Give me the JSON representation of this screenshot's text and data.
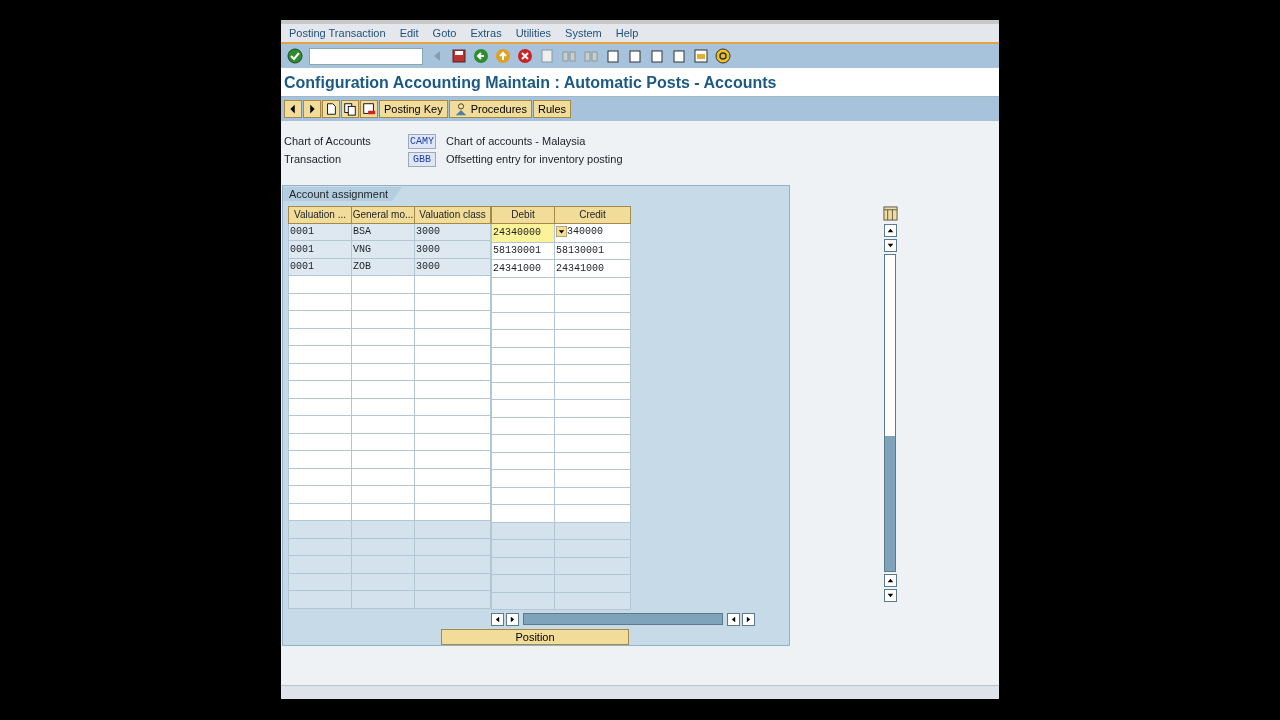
{
  "menu": [
    "Posting Transaction",
    "Edit",
    "Goto",
    "Extras",
    "Utilities",
    "System",
    "Help"
  ],
  "title": "Configuration Accounting Maintain : Automatic Posts - Accounts",
  "app_toolbar": [
    {
      "kind": "icon"
    },
    {
      "kind": "icon"
    },
    {
      "kind": "icon"
    },
    {
      "kind": "icon"
    },
    {
      "kind": "icon"
    },
    {
      "kind": "text",
      "label": "Posting Key"
    },
    {
      "kind": "iconText",
      "label": "Procedures"
    },
    {
      "kind": "text",
      "label": "Rules"
    }
  ],
  "fields": [
    {
      "label": "Chart of Accounts",
      "value": "CAMY",
      "description": "Chart of accounts - Malaysia"
    },
    {
      "label": "Transaction",
      "value": "GBB",
      "description": "Offsetting entry for inventory posting"
    }
  ],
  "group": {
    "title": "Account assignment",
    "key_columns": [
      "Valuation ...",
      "General mo...",
      "Valuation class"
    ],
    "account_columns": [
      "Debit",
      "Credit"
    ],
    "rows": [
      {
        "cells": [
          "0001",
          "BSA",
          "3000"
        ],
        "debit": "24340000",
        "credit": "340000",
        "focused": true,
        "dropdown": true
      },
      {
        "cells": [
          "0001",
          "VNG",
          "3000"
        ],
        "debit": "58130001",
        "credit": "58130001",
        "focused": false,
        "dropdown": false
      },
      {
        "cells": [
          "0001",
          "ZOB",
          "3000"
        ],
        "debit": "24341000",
        "credit": "24341000",
        "focused": false,
        "dropdown": false
      }
    ],
    "button": "Position"
  }
}
